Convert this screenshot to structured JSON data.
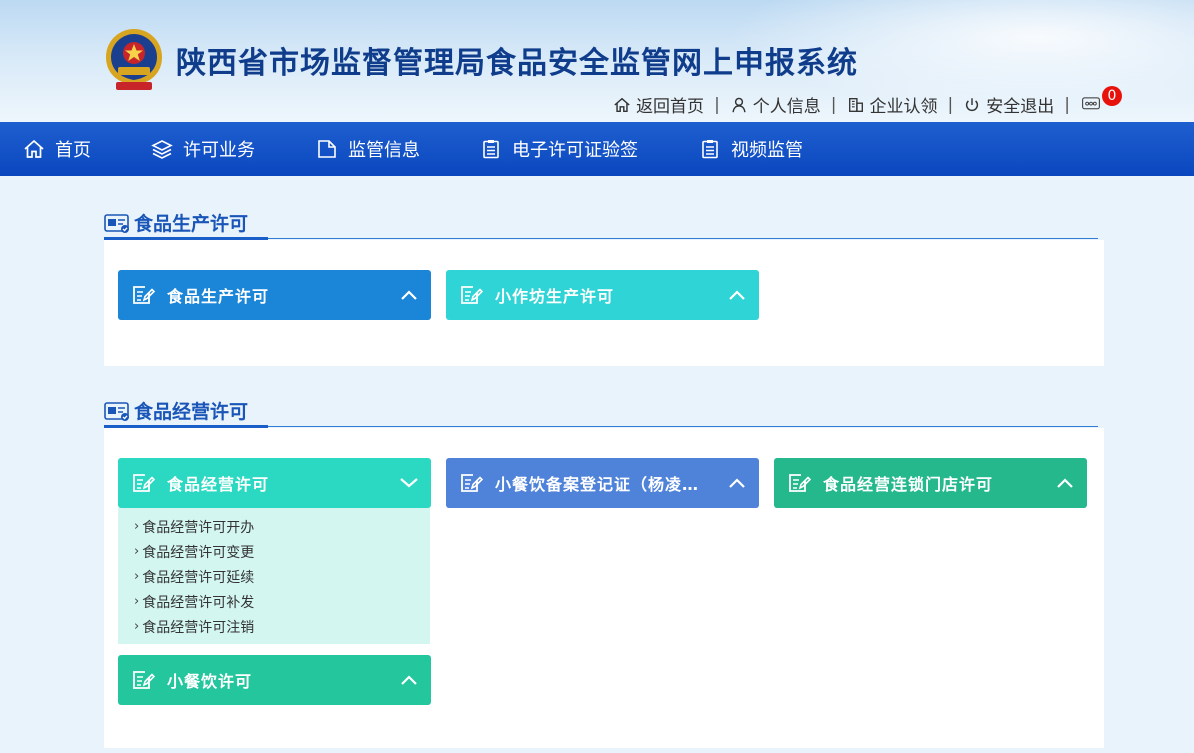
{
  "header": {
    "title": "陕西省市场监督管理局食品安全监管网上申报系统",
    "links": [
      {
        "label": "返回首页",
        "icon": "home-icon"
      },
      {
        "label": "个人信息",
        "icon": "user-icon"
      },
      {
        "label": "企业认领",
        "icon": "building-icon"
      },
      {
        "label": "安全退出",
        "icon": "power-icon"
      }
    ],
    "separator": "|",
    "message_count": "0"
  },
  "nav": {
    "items": [
      {
        "label": "首页",
        "icon": "home-icon"
      },
      {
        "label": "许可业务",
        "icon": "layers-icon"
      },
      {
        "label": "监管信息",
        "icon": "document-icon"
      },
      {
        "label": "电子许可证验签",
        "icon": "clipboard-icon"
      },
      {
        "label": "视频监管",
        "icon": "clipboard-icon"
      }
    ]
  },
  "sections": [
    {
      "title": "食品生产许可",
      "cards": [
        {
          "label": "食品生产许可",
          "color": "#1b85d8",
          "state": "collapsed"
        },
        {
          "label": "小作坊生产许可",
          "color": "#2fd4d6",
          "state": "collapsed"
        }
      ]
    },
    {
      "title": "食品经营许可",
      "cards": [
        {
          "label": "食品经营许可",
          "color": "#2bd9c2",
          "state": "expanded",
          "submenu": [
            "食品经营许可开办",
            "食品经营许可变更",
            "食品经营许可延续",
            "食品经营许可补发",
            "食品经营许可注销"
          ]
        },
        {
          "label": "小餐饮备案登记证（杨凌示…",
          "color": "#4f82d9",
          "state": "collapsed"
        },
        {
          "label": "食品经营连锁门店许可",
          "color": "#25b88d",
          "state": "collapsed"
        },
        {
          "label": "小餐饮许可",
          "color": "#23c69d",
          "state": "collapsed"
        }
      ]
    }
  ],
  "colors": {
    "nav_bg": "#0a47bf",
    "title": "#0f3d8c",
    "accent": "#1a56b8",
    "badge": "#e8120c"
  }
}
